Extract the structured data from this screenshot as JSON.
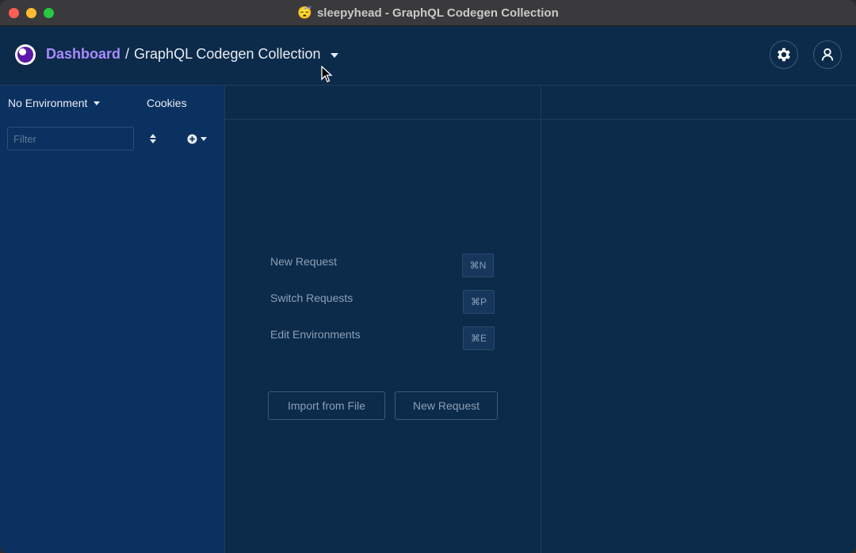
{
  "window": {
    "title": "sleepyhead - GraphQL Codegen Collection",
    "title_emoji": "😴"
  },
  "header": {
    "breadcrumb_root": "Dashboard",
    "breadcrumb_separator": "/",
    "collection_name": "GraphQL Codegen Collection",
    "brand_color": "#a98bff"
  },
  "sidebar": {
    "environment": "No Environment",
    "cookies": "Cookies",
    "filter_placeholder": "Filter",
    "filter_value": ""
  },
  "shortcuts": [
    {
      "label": "New Request",
      "key": "⌘N"
    },
    {
      "label": "Switch Requests",
      "key": "⌘P"
    },
    {
      "label": "Edit Environments",
      "key": "⌘E"
    }
  ],
  "actions": {
    "import_label": "Import from File",
    "new_request_label": "New Request"
  },
  "colors": {
    "background": "#0c2a4a",
    "sidebar": "#0b3161",
    "text": "#e8edf3",
    "muted": "#8aa0b8"
  }
}
